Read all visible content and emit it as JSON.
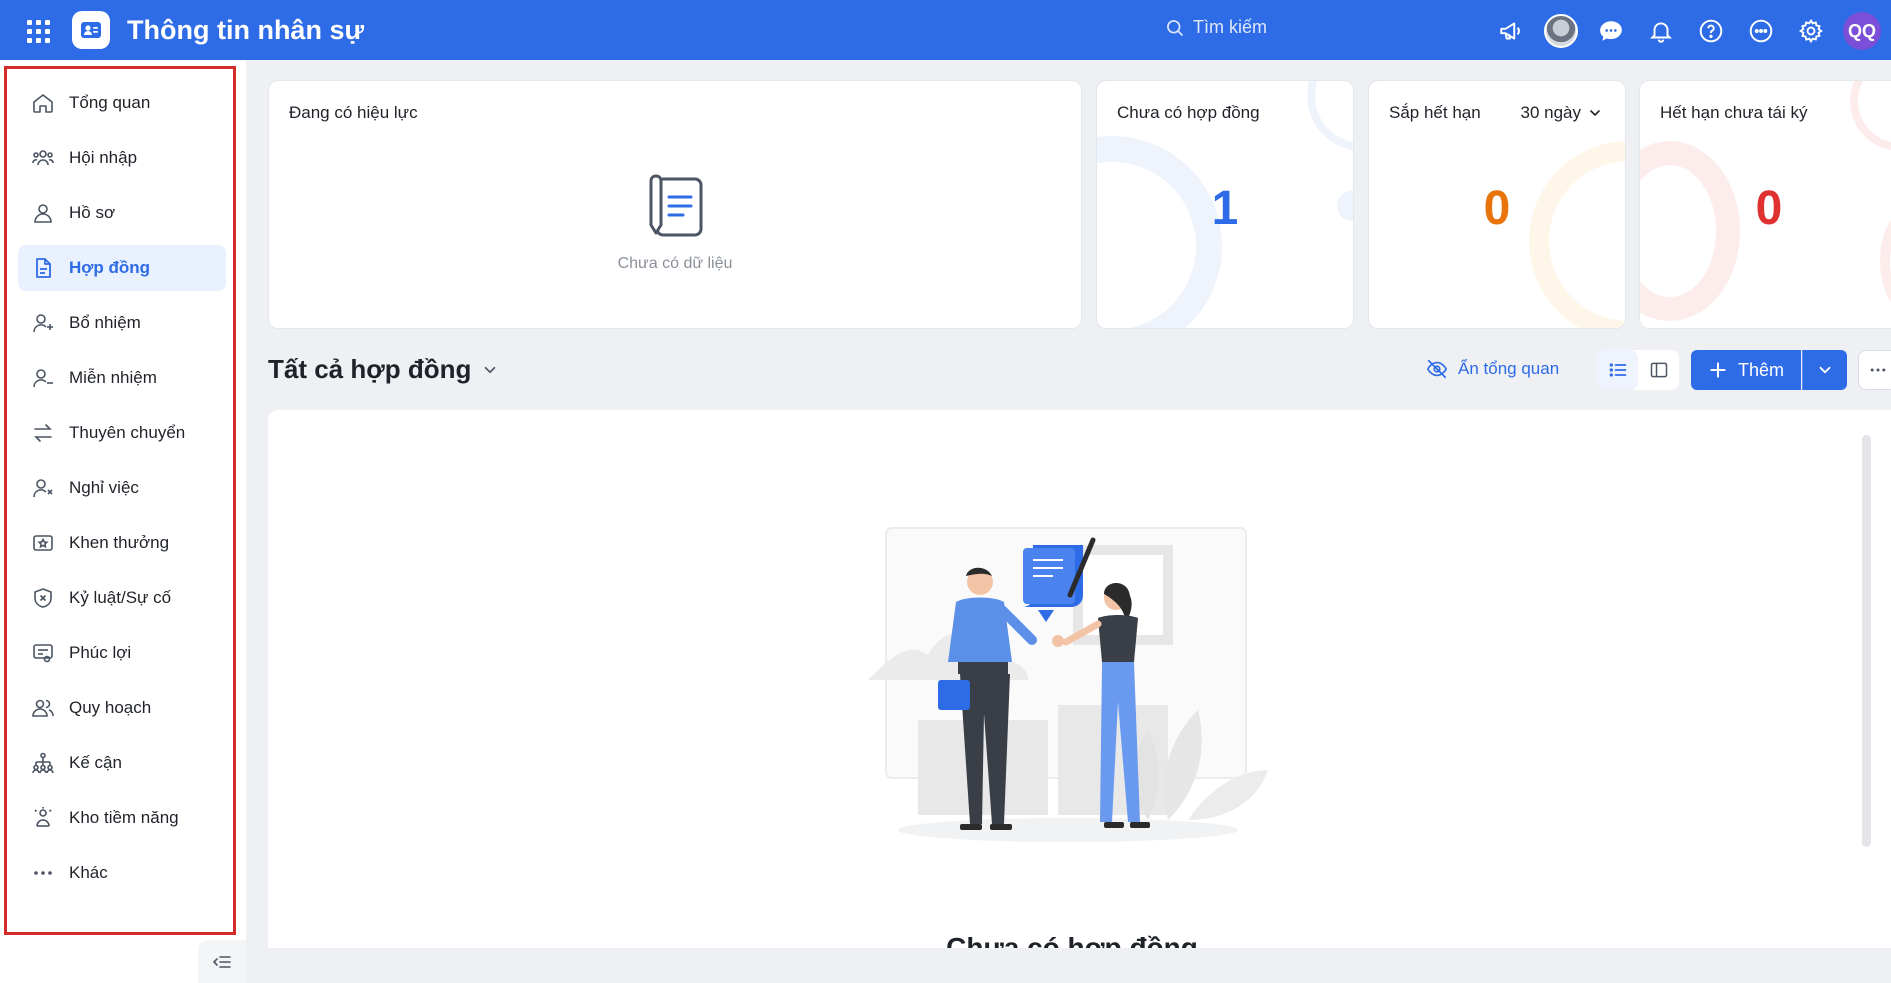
{
  "header": {
    "app_title": "Thông tin nhân sự",
    "search_placeholder": "Tìm kiếm",
    "avatar_initials": "QQ",
    "accent_color": "#2e6be6"
  },
  "sidebar": {
    "items": [
      {
        "label": "Tổng quan",
        "icon": "home-icon"
      },
      {
        "label": "Hội nhập",
        "icon": "team-icon"
      },
      {
        "label": "Hồ sơ",
        "icon": "person-icon"
      },
      {
        "label": "Hợp đồng",
        "icon": "document-icon",
        "active": true
      },
      {
        "label": "Bổ nhiệm",
        "icon": "person-add-icon"
      },
      {
        "label": "Miễn nhiệm",
        "icon": "person-remove-icon"
      },
      {
        "label": "Thuyên chuyển",
        "icon": "transfer-icon"
      },
      {
        "label": "Nghỉ việc",
        "icon": "person-x-icon"
      },
      {
        "label": "Khen thưởng",
        "icon": "award-icon"
      },
      {
        "label": "Kỷ luật/Sự cố",
        "icon": "shield-x-icon"
      },
      {
        "label": "Phúc lợi",
        "icon": "benefit-icon"
      },
      {
        "label": "Quy hoạch",
        "icon": "people-icon"
      },
      {
        "label": "Kế cận",
        "icon": "hierarchy-icon"
      },
      {
        "label": "Kho tiềm năng",
        "icon": "talent-pool-icon"
      },
      {
        "label": "Khác",
        "icon": "more-dots-icon"
      }
    ]
  },
  "cards": {
    "effective": {
      "title": "Đang có hiệu lực",
      "empty_text": "Chưa có dữ liệu"
    },
    "no_contract": {
      "title": "Chưa có hợp đồng",
      "value": "1",
      "color": "#2e6be6"
    },
    "expiring": {
      "title": "Sắp hết hạn",
      "value": "0",
      "period": "30 ngày",
      "color": "#e8740c"
    },
    "expired": {
      "title": "Hết hạn chưa tái ký",
      "value": "0",
      "color": "#e03131"
    }
  },
  "section": {
    "title": "Tất cả hợp đồng",
    "hide_overview": "Ẩn tổng quan",
    "add_label": "Thêm"
  },
  "main": {
    "empty_title": "Chưa có hợp đồng"
  }
}
